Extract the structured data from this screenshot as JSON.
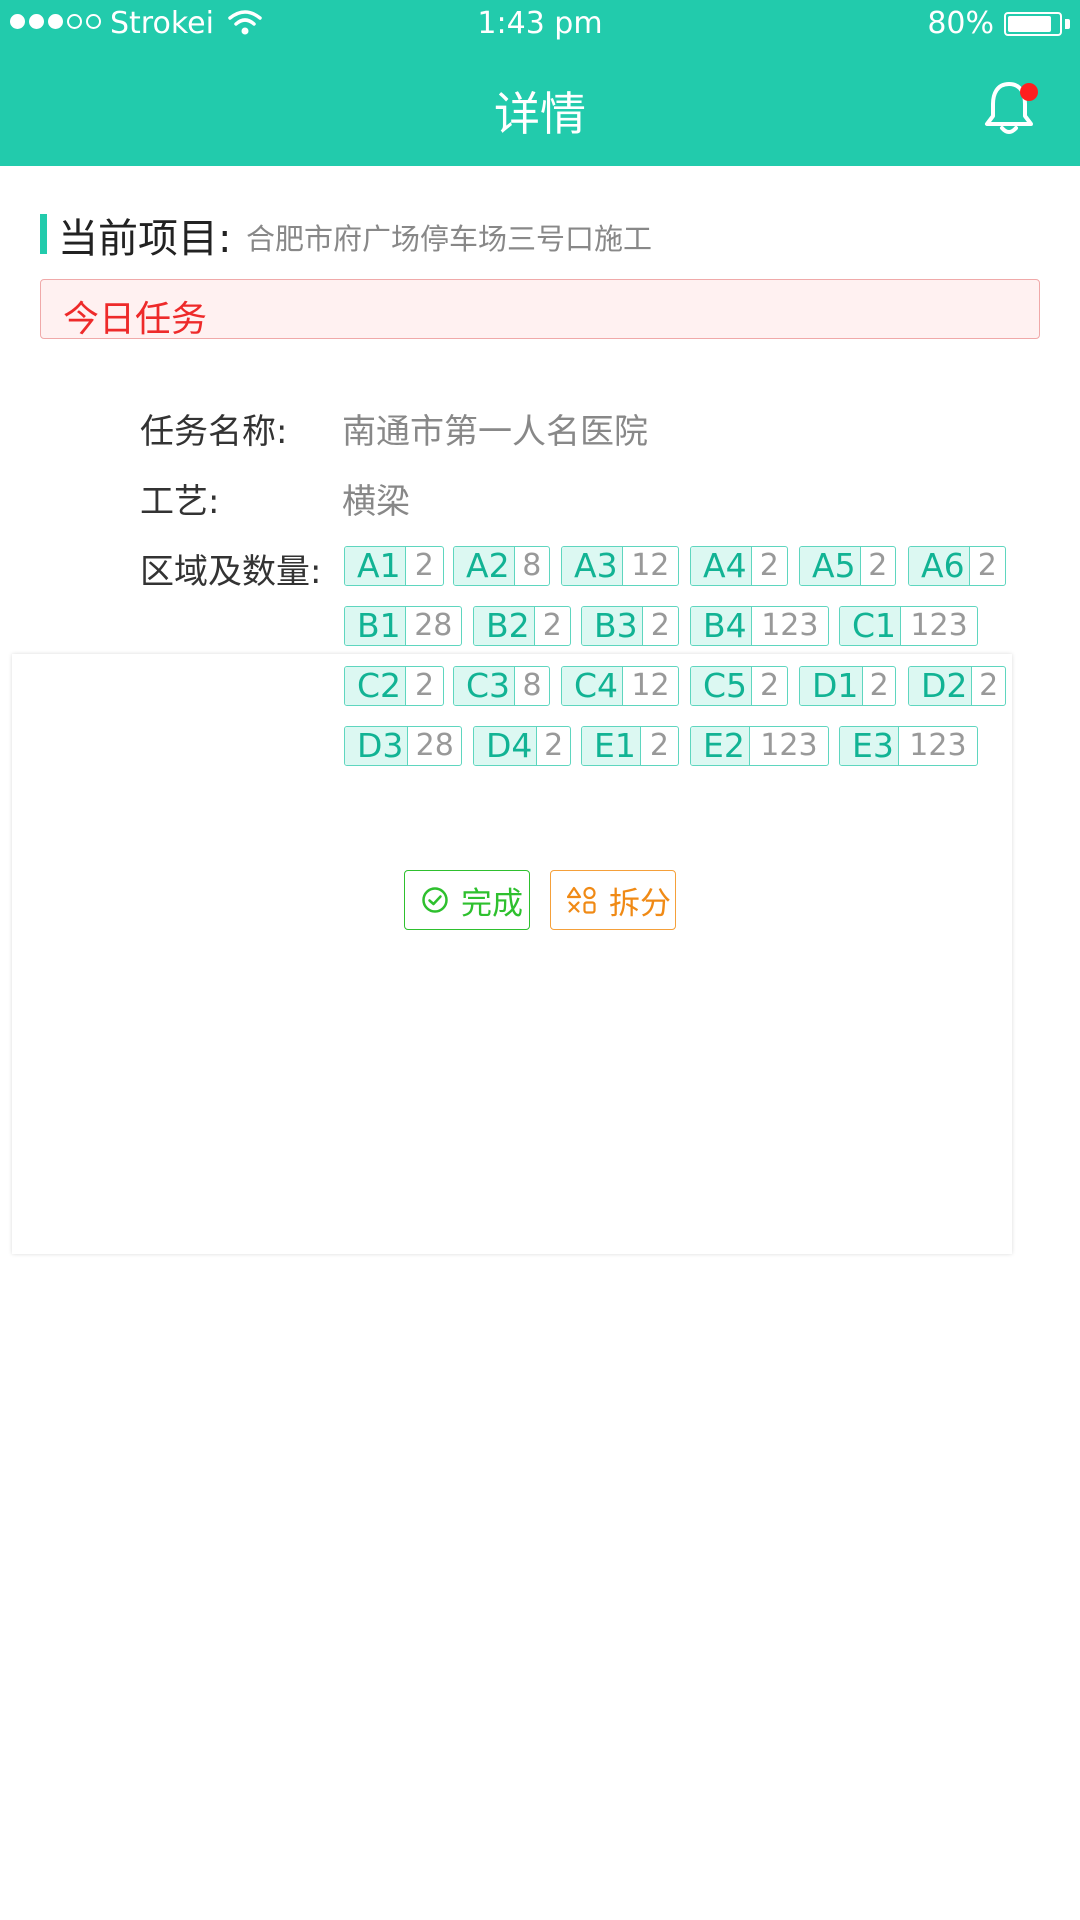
{
  "status_bar": {
    "carrier": "Strokei",
    "time": "1:43 pm",
    "battery": "80%"
  },
  "nav": {
    "title": "详情",
    "bell_icon": "bell-icon",
    "has_notification": true
  },
  "project": {
    "label": "当前项目:",
    "value": "合肥市府广场停车场三号口施工"
  },
  "today_tasks": {
    "label": "今日任务"
  },
  "task": {
    "name_label": "任务名称:",
    "name_value": "南通市第一人名医院",
    "process_label": "工艺:",
    "process_value": "横梁",
    "areas_label": "区域及数量:",
    "areas": [
      {
        "code": "A1",
        "qty": "2"
      },
      {
        "code": "A2",
        "qty": "8"
      },
      {
        "code": "A3",
        "qty": "12"
      },
      {
        "code": "A4",
        "qty": "2"
      },
      {
        "code": "A5",
        "qty": "2"
      },
      {
        "code": "A6",
        "qty": "2"
      },
      {
        "code": "B1",
        "qty": "28"
      },
      {
        "code": "B2",
        "qty": "2"
      },
      {
        "code": "B3",
        "qty": "2"
      },
      {
        "code": "B4",
        "qty": "123"
      },
      {
        "code": "C1",
        "qty": "123"
      },
      {
        "code": "C2",
        "qty": "2"
      },
      {
        "code": "C3",
        "qty": "8"
      },
      {
        "code": "C4",
        "qty": "12"
      },
      {
        "code": "C5",
        "qty": "2"
      },
      {
        "code": "D1",
        "qty": "2"
      },
      {
        "code": "D2",
        "qty": "2"
      },
      {
        "code": "D3",
        "qty": "28"
      },
      {
        "code": "D4",
        "qty": "2"
      },
      {
        "code": "E1",
        "qty": "2"
      },
      {
        "code": "E2",
        "qty": "123"
      },
      {
        "code": "E3",
        "qty": "123"
      }
    ]
  },
  "actions": {
    "complete_label": "完成",
    "split_label": "拆分"
  },
  "colors": {
    "primary": "#22cbac",
    "alert_red": "#ee2a2a",
    "complete_green": "#2ec02e",
    "split_orange": "#f08a15"
  }
}
